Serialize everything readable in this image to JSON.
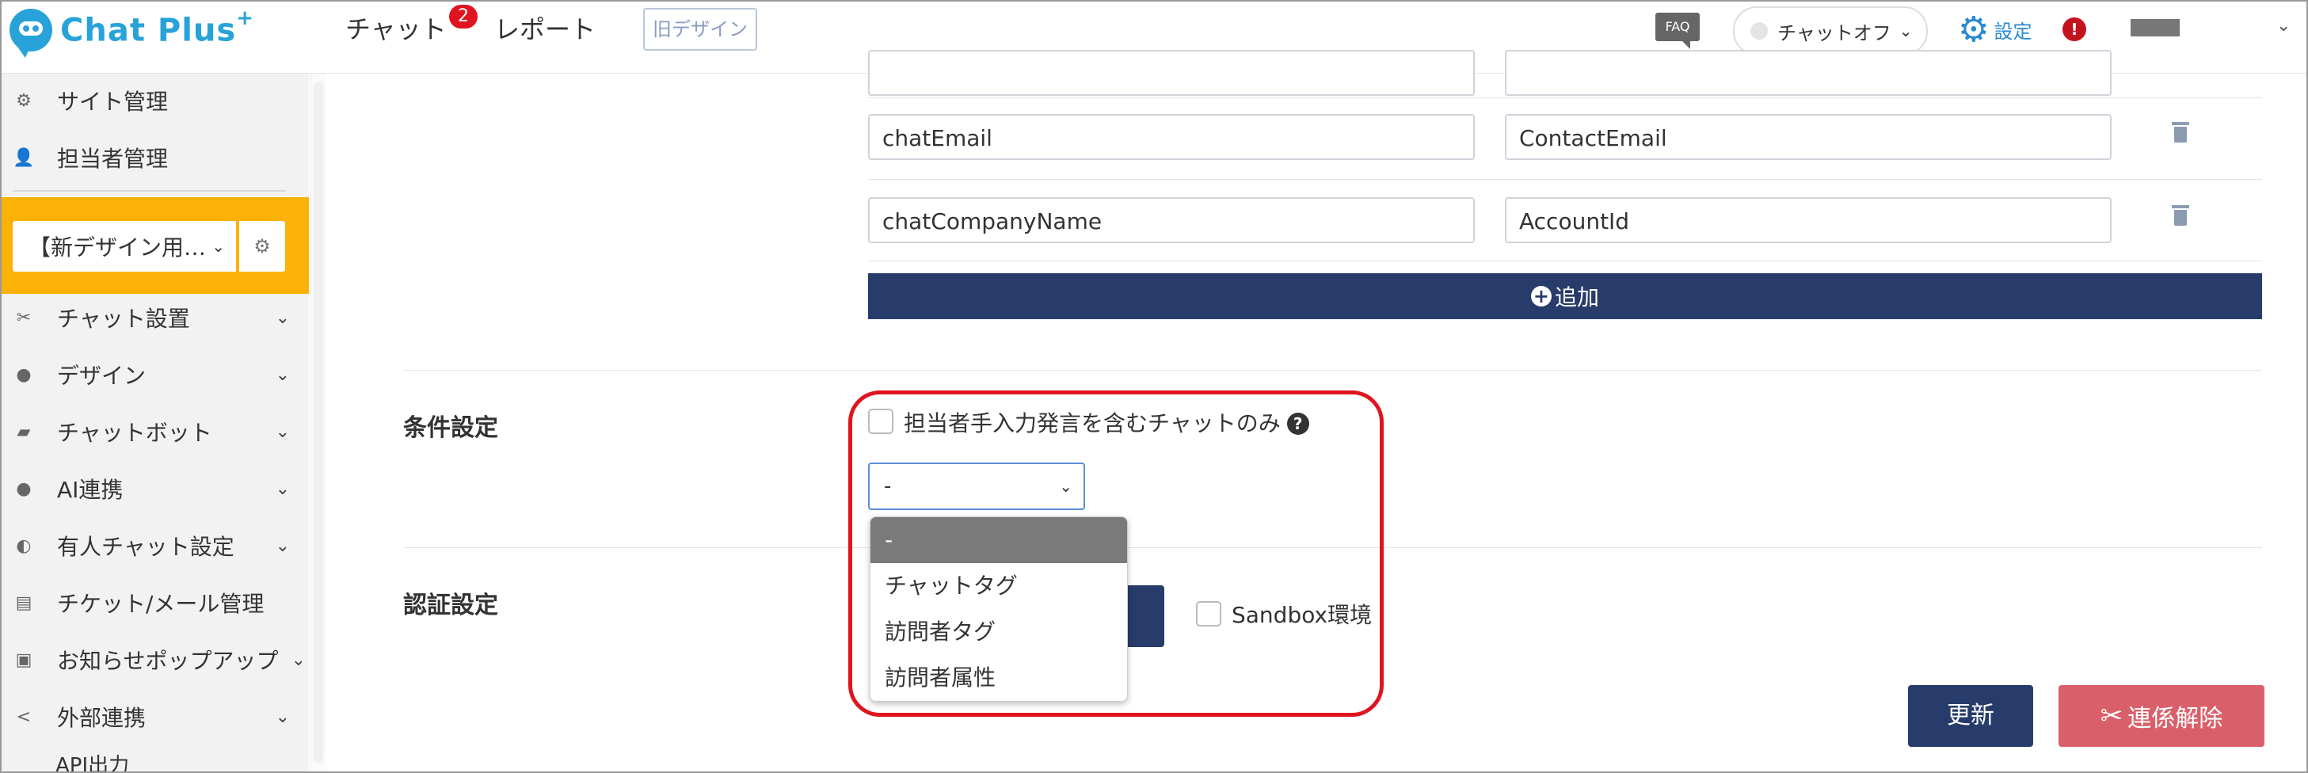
{
  "header": {
    "logo_text": "Chat Plus",
    "logo_sup": "+",
    "nav_chat": "チャット",
    "nav_chat_badge": "2",
    "nav_report": "レポート",
    "old_design": "旧デザイン",
    "faq": "FAQ",
    "chat_status": "チャットオフ",
    "settings": "設定",
    "alert": "!"
  },
  "sidebar": {
    "site_admin": "サイト管理",
    "agent_admin": "担当者管理",
    "site_select": "【新デザイン用…",
    "items": [
      {
        "label": "チャット設置",
        "icon": "tools-icon"
      },
      {
        "label": "デザイン",
        "icon": "palette-icon"
      },
      {
        "label": "チャットボット",
        "icon": "chat-bubbles-icon"
      },
      {
        "label": "AI連携",
        "icon": "ai-icon"
      },
      {
        "label": "有人チャット設定",
        "icon": "headset-icon"
      },
      {
        "label": "チケット/メール管理",
        "icon": "ticket-icon"
      },
      {
        "label": "お知らせポップアップ",
        "icon": "popup-icon"
      },
      {
        "label": "外部連携",
        "icon": "share-icon"
      }
    ],
    "sub_item": "API出力"
  },
  "mapping_rows": [
    {
      "left": "chatEmail",
      "right": "ContactEmail"
    },
    {
      "left": "chatCompanyName",
      "right": "AccountId"
    }
  ],
  "add_button": "追加",
  "condition": {
    "label": "条件設定",
    "checkbox_label": "担当者手入力発言を含むチャットのみ",
    "select_value": "-",
    "options": [
      "-",
      "チャットタグ",
      "訪問者タグ",
      "訪問者属性"
    ]
  },
  "auth": {
    "label": "認証設定",
    "sandbox_label": "Sandbox環境"
  },
  "buttons": {
    "update": "更新",
    "unlink": "連係解除"
  },
  "colors": {
    "brand": "#27a3d9",
    "navy": "#283c6b",
    "highlight": "#e0141e",
    "sidebar_site_box": "#fbb106",
    "danger_button": "#d9606a"
  }
}
